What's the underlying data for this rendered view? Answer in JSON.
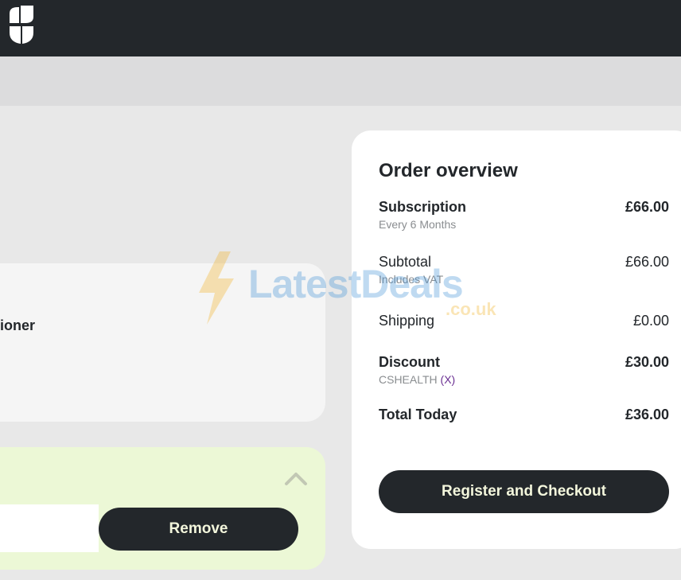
{
  "header": {
    "logo_icon": "brand-logo-icon"
  },
  "product": {
    "name_visible": "ioner"
  },
  "discount_panel": {
    "collapse_icon": "chevron-up-icon",
    "code_input_value": "",
    "remove_label": "Remove"
  },
  "overview": {
    "title": "Order overview",
    "subscription": {
      "label": "Subscription",
      "detail": "Every 6 Months",
      "amount": "£66.00"
    },
    "subtotal": {
      "label": "Subtotal",
      "detail": "Includes VAT",
      "amount": "£66.00"
    },
    "shipping": {
      "label": "Shipping",
      "amount": "£0.00"
    },
    "discount": {
      "label": "Discount",
      "code": "CSHEALTH",
      "remove_code": "(X)",
      "amount": "£30.00"
    },
    "total": {
      "label": "Total Today",
      "amount": "£36.00"
    },
    "checkout_label": "Register and Checkout"
  },
  "watermark": {
    "brand": "LatestDeals",
    "domain": ".co.uk"
  },
  "colors": {
    "dark": "#23272b",
    "button_text": "#f3f6dc",
    "discount_panel_bg": "#ecf8d6",
    "remove_code_link": "#6a2f92"
  }
}
